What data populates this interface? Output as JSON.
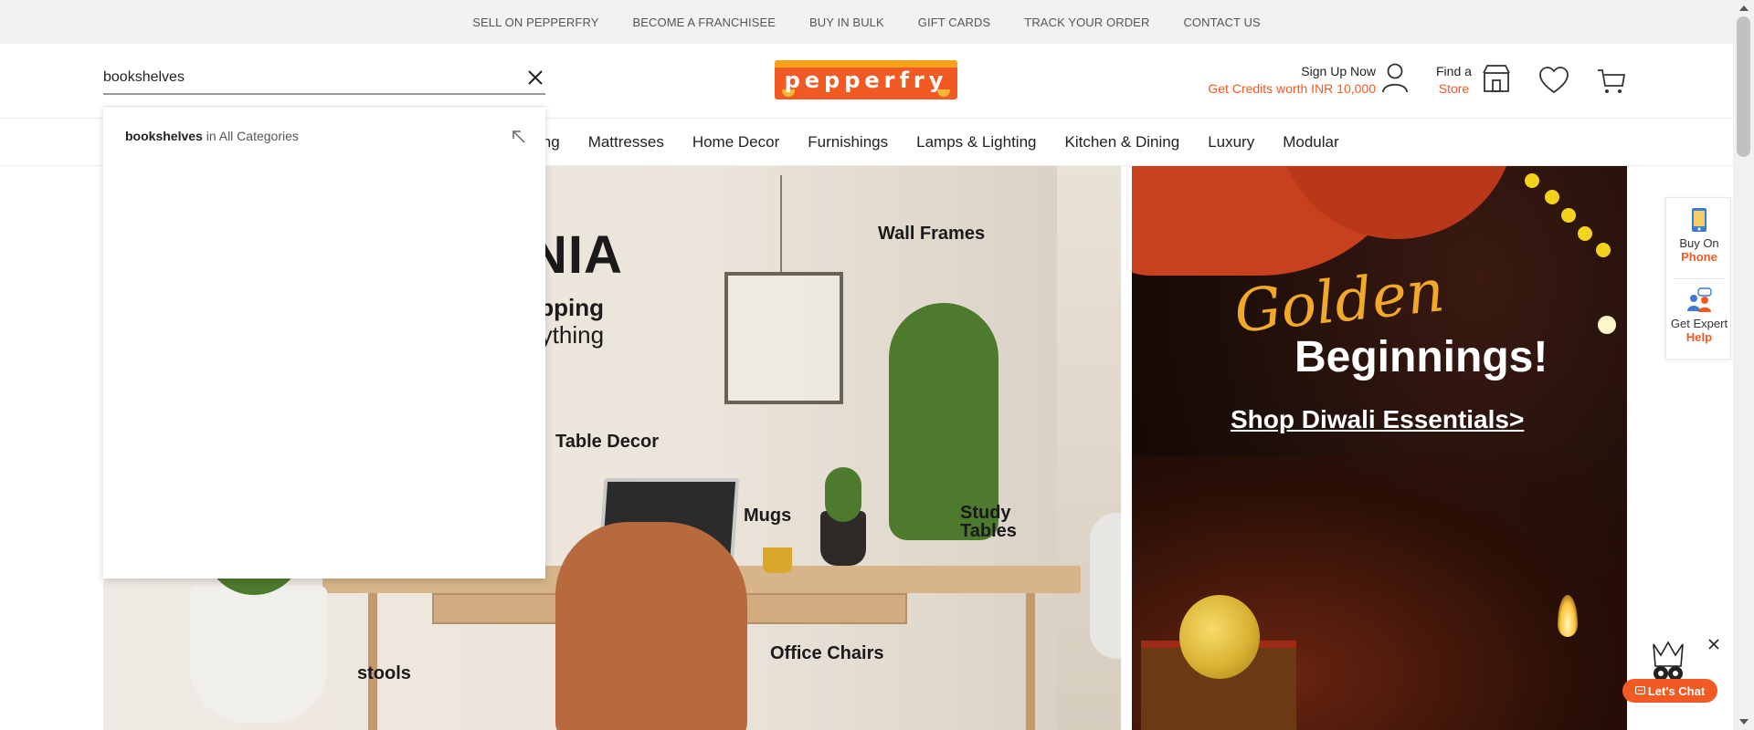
{
  "topbar": {
    "links": [
      "SELL ON PEPPERFRY",
      "BECOME A FRANCHISEE",
      "BUY IN BULK",
      "GIFT CARDS",
      "TRACK YOUR ORDER",
      "CONTACT US"
    ]
  },
  "header": {
    "search": {
      "value": "bookshelves",
      "placeholder": ""
    },
    "logo_text": "pepperfry",
    "signup": {
      "title": "Sign Up Now",
      "subtitle": "Get Credits worth INR 10,000"
    },
    "findstore": {
      "line1": "Find a",
      "line2": "Store"
    }
  },
  "nav": {
    "items": [
      "ing",
      "Mattresses",
      "Home Decor",
      "Furnishings",
      "Lamps & Lighting",
      "Kitchen & Dining",
      "Luxury",
      "Modular"
    ]
  },
  "suggestions": [
    {
      "keyword": "bookshelves",
      "category": " in All Categories"
    }
  ],
  "banner_left": {
    "big": "NIA",
    "sub1": "ipping",
    "sub2": "rything",
    "labels": {
      "wall_frames": "Wall Frames",
      "table_decor": "Table Decor",
      "mugs": "Mugs",
      "study_tables_1": "Study",
      "study_tables_2": "Tables",
      "office_chairs": "Office Chairs",
      "stools": "stools"
    }
  },
  "banner_right": {
    "golden": "Golden",
    "beginnings": "Beginnings!",
    "cta": "Shop Diwali Essentials>"
  },
  "side_widgets": {
    "phone": {
      "line1": "Buy On",
      "line2": "Phone"
    },
    "expert": {
      "line1": "Get Expert",
      "line2": "Help"
    }
  },
  "chat": {
    "label": "Let's Chat"
  },
  "colors": {
    "brand": "#f15a22",
    "topbar_bg": "#f2f2f2"
  }
}
